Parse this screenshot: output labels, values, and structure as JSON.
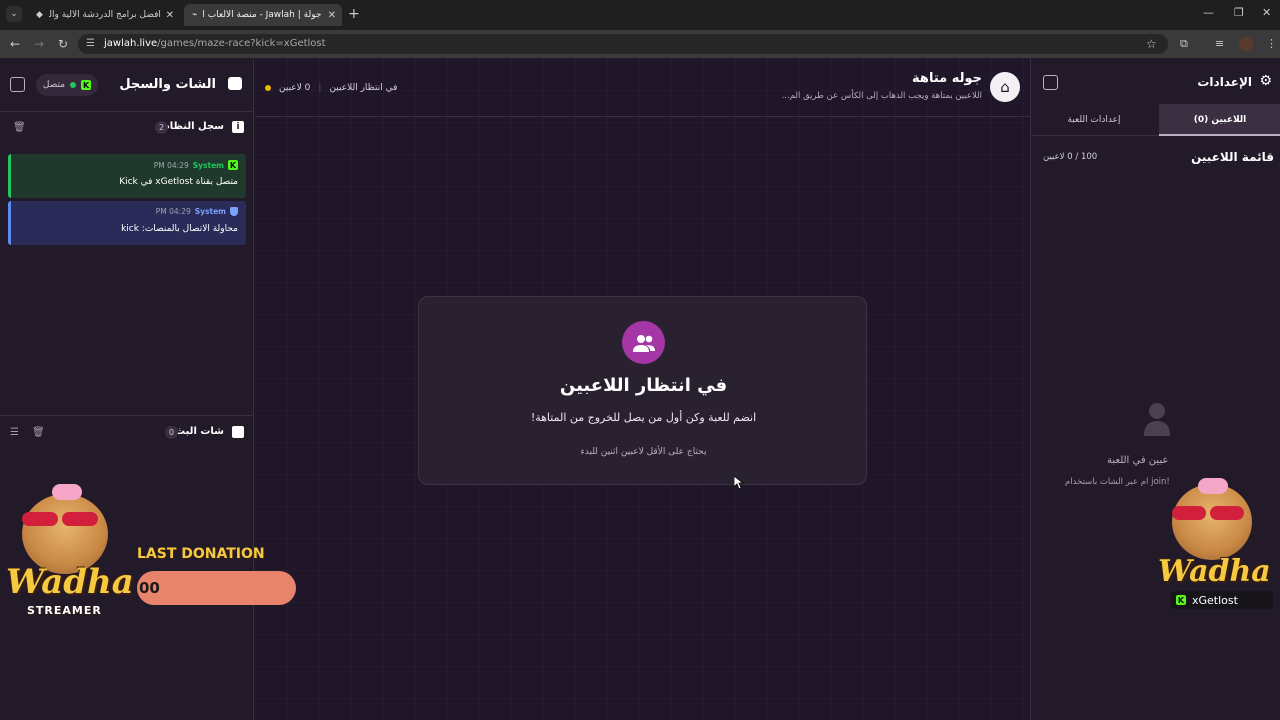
{
  "browser": {
    "tabs": [
      {
        "label": "أفضل برامج الدردشة الآلية والوي...",
        "active": false
      },
      {
        "label": "جولة | Jawlah - منصة الألعاب الت...",
        "active": true
      }
    ],
    "url_host": "jawlah.live",
    "url_path": "/games/maze-race?kick=xGetlost"
  },
  "left_panel": {
    "title": "الشات والسجل",
    "status": "متصل",
    "system_log": {
      "title": "سجل النظام",
      "count": "2",
      "entries": [
        {
          "sender": "System",
          "time": "04:29 PM",
          "message": "متصل بقناة xGetlost في Kick",
          "color": "#22c55e"
        },
        {
          "sender": "System",
          "time": "04:29 PM",
          "message": "محاولة الاتصال بالمنصات: kick",
          "color": "#5b8def"
        }
      ]
    },
    "stream_chat": {
      "title": "شات البث",
      "count": "0"
    }
  },
  "overlay_left": {
    "brand": "Wadha",
    "subtitle": "STREAMER",
    "last_donation_label": "LAST DONATION",
    "donation_value": "00"
  },
  "center": {
    "game_title": "جوله متاهة",
    "game_subtitle": "اللاعبين بمتاهة ويجب الذهاب إلى الكأس عن طريق الم...",
    "status_text": "في انتظار اللاعبين",
    "players_count": "0 لاعبين",
    "card": {
      "title": "في انتظار اللاعبين",
      "description": "انضم للعبة وكن أول من يصل للخروج من المتاهة!",
      "note": "يحتاج على الأقل لاعبين اثنين للبدء"
    }
  },
  "right_panel": {
    "title": "الإعدادات",
    "tabs": [
      {
        "label": "اللاعبين (0)",
        "active": true
      },
      {
        "label": "إعدادات اللعبة",
        "active": false
      }
    ],
    "players_title": "قائمة اللاعبين",
    "players_capacity": "100 / 0 لاعبين",
    "empty_title": "عبين في اللعبة",
    "empty_hint": "!join ام عبر الشات باستخدام"
  },
  "overlay_right": {
    "brand": "Wadha",
    "username": "xGetlost"
  },
  "colors": {
    "accent": "#a436a6",
    "kick_green": "#53fc18",
    "donation_bar": "#e9846c",
    "brand_yellow": "#f6c940"
  }
}
